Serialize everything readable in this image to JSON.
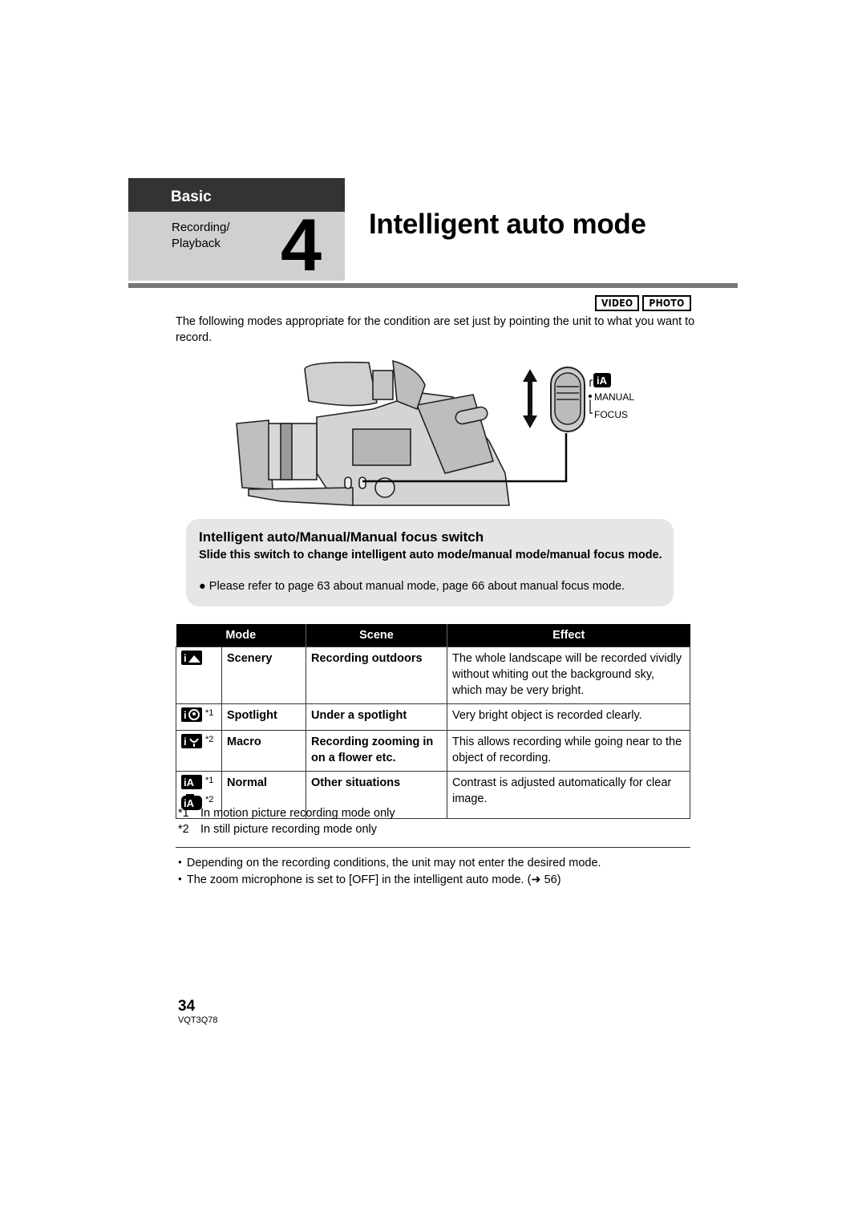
{
  "header": {
    "section": "Basic",
    "subsection_line1": "Recording/",
    "subsection_line2": "Playback",
    "chapter_number": "4",
    "title": "Intelligent auto mode"
  },
  "badges": [
    "VIDEO",
    "PHOTO"
  ],
  "intro": "The following modes appropriate for the condition are set just by pointing the unit to what you want to record.",
  "illustration": {
    "switch_labels": [
      "iA",
      "MANUAL",
      "FOCUS"
    ],
    "icon": "camcorder-illustration"
  },
  "infobox": {
    "heading": "Intelligent auto/Manual/Manual focus switch",
    "body": "Slide this switch to change intelligent auto mode/manual mode/manual focus mode.",
    "note": "Please refer to page 63 about manual mode, page 66 about manual focus mode."
  },
  "table": {
    "headers": [
      "Mode",
      "Scene",
      "Effect"
    ],
    "rows": [
      {
        "icon": "scenery-icon",
        "icon_text": "i▲",
        "mark": "",
        "mode": "Scenery",
        "scene": "Recording outdoors",
        "effect": "The whole landscape will be recorded vividly without whiting out the background sky, which may be very bright."
      },
      {
        "icon": "spotlight-icon",
        "icon_text": "i☺",
        "mark": "*1",
        "mode": "Spotlight",
        "scene": "Under a spotlight",
        "effect": "Very bright object is recorded clearly."
      },
      {
        "icon": "macro-icon",
        "icon_text": "i✿",
        "mark": "*2",
        "mode": "Macro",
        "scene": "Recording zooming in on a flower etc.",
        "effect": "This allows recording while going near to the object of recording."
      },
      {
        "icon": "intelligent-auto-icon",
        "icon_text": "iA",
        "mark": "*1",
        "icon2_text": "iA",
        "mark2": "*2",
        "mode": "Normal",
        "scene": "Other situations",
        "effect": "Contrast is adjusted automatically for clear image."
      }
    ]
  },
  "footnotes": [
    {
      "key": "*1",
      "text": "In motion picture recording mode only"
    },
    {
      "key": "*2",
      "text": "In still picture recording mode only"
    }
  ],
  "notes": [
    "Depending on the recording conditions, the unit may not enter the desired mode.",
    "The zoom microphone is set to [OFF] in the intelligent auto mode. (➜ 56)"
  ],
  "footer": {
    "page_number": "34",
    "code": "VQT3Q78"
  }
}
